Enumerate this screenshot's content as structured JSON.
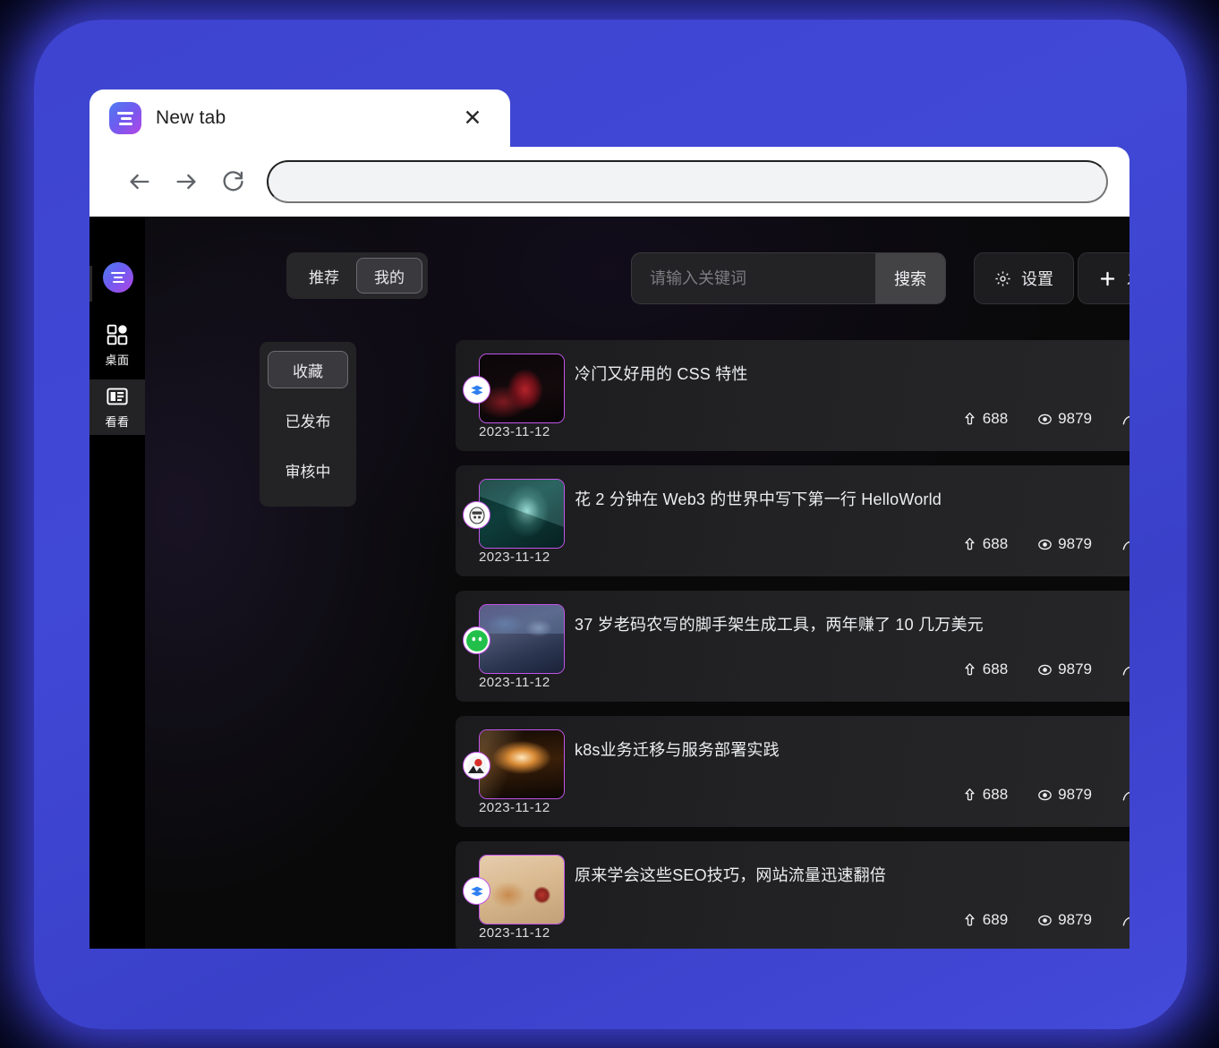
{
  "browser": {
    "tab_title": "New tab",
    "close_label": "✕",
    "back_icon": "back-arrow-icon",
    "forward_icon": "forward-arrow-icon",
    "reload_icon": "reload-icon",
    "address_value": "",
    "address_placeholder": ""
  },
  "app": {
    "rail": {
      "items": [
        {
          "label": "桌面",
          "icon": "grid-apps-icon",
          "active": false
        },
        {
          "label": "看看",
          "icon": "panel-layout-icon",
          "active": true
        }
      ]
    },
    "toolbar": {
      "segments": [
        {
          "label": "推荐",
          "active": false
        },
        {
          "label": "我的",
          "active": true
        }
      ],
      "search": {
        "value": "",
        "placeholder": "请输入关键词",
        "button_label": "搜索"
      },
      "settings_label": "设置",
      "settings_icon": "gear-icon",
      "publish_label": "发布",
      "publish_icon": "plus-icon"
    },
    "filters": [
      {
        "label": "收藏",
        "active": true
      },
      {
        "label": "已发布",
        "active": false
      },
      {
        "label": "审核中",
        "active": false
      }
    ],
    "stat_icons": {
      "likes": "up-arrow-icon",
      "views": "eye-target-icon",
      "share": "share-arrow-icon"
    },
    "articles": [
      {
        "title": "冷门又好用的 CSS 特性",
        "date": "2023-11-12",
        "likes": "688",
        "views": "9879",
        "badge_icon": "layers-chevron-icon",
        "thumb_desc": "dark-red-figure-photo"
      },
      {
        "title": "花 2 分钟在 Web3 的世界中写下第一行 HelloWorld",
        "date": "2023-11-12",
        "likes": "688",
        "views": "9879",
        "badge_icon": "ghost-avatar-icon",
        "thumb_desc": "teal-crystal-3d-render"
      },
      {
        "title": "37 岁老码农写的脚手架生成工具，两年赚了 10 几万美元",
        "date": "2023-11-12",
        "likes": "688",
        "views": "9879",
        "badge_icon": "green-smiley-icon",
        "thumb_desc": "desk-setup-photo"
      },
      {
        "title": "k8s业务迁移与服务部署实践",
        "date": "2023-11-12",
        "likes": "688",
        "views": "9879",
        "badge_icon": "mountain-avatar-icon",
        "thumb_desc": "light-streaks-photo"
      },
      {
        "title": "原来学会这些SEO技巧，网站流量迅速翻倍",
        "date": "2023-11-12",
        "likes": "689",
        "views": "9879",
        "badge_icon": "layers-chevron-icon",
        "thumb_desc": "seo-wooden-letters-photo"
      }
    ]
  },
  "colors": {
    "backdrop_blue": "#4048d6",
    "accent_purple": "#c255e8",
    "badge_blue": "#2f7ff0",
    "surface_dark": "#09090a",
    "card_gradient_start": "#1b1b1d",
    "card_gradient_end": "#262628"
  }
}
